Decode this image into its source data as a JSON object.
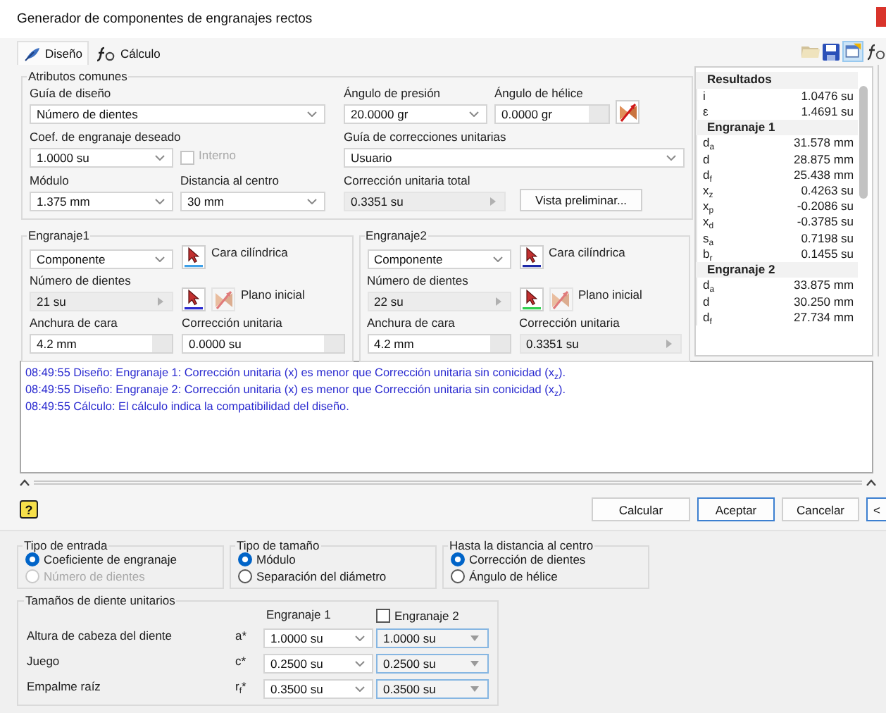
{
  "window": {
    "title": "Generador de componentes de engranajes rectos"
  },
  "tabs": [
    {
      "label": "Diseño",
      "selected": true
    },
    {
      "label": "Cálculo",
      "selected": false
    }
  ],
  "common": {
    "title": "Atributos comunes",
    "design_guide": {
      "label": "Guía de diseño",
      "value": "Número de dientes",
      "kind": "combo"
    },
    "pressure_angle": {
      "label": "Ángulo de presión",
      "value": "20.0000 gr",
      "kind": "combo"
    },
    "helix_angle": {
      "label": "Ángulo de hélice",
      "value": "0.0000 gr",
      "kind": "text"
    },
    "gear_ratio": {
      "label": "Coef. de engranaje deseado",
      "value": "1.0000 su",
      "kind": "combo"
    },
    "internal": {
      "label": "Interno",
      "checked": false,
      "disabled": true
    },
    "correction_guide": {
      "label": "Guía de correcciones unitarias",
      "value": "Usuario",
      "kind": "combo"
    },
    "module": {
      "label": "Módulo",
      "value": "1.375 mm",
      "kind": "combo"
    },
    "center_distance": {
      "label": "Distancia al centro",
      "value": "30 mm",
      "kind": "combo"
    },
    "total_correction": {
      "label": "Corrección unitaria total",
      "value": "0.3351 su",
      "kind": "spin"
    },
    "preview_button": "Vista preliminar..."
  },
  "gears": [
    {
      "title": "Engranaje1",
      "component": {
        "value": "Componente",
        "kind": "combo"
      },
      "cylinder_face": "Cara cilíndrica",
      "start_plane": "Plano inicial",
      "teeth": {
        "label": "Número de dientes",
        "value": "21 su",
        "kind": "spin"
      },
      "face_width": {
        "label": "Anchura de cara",
        "value": "4.2 mm",
        "kind": "text"
      },
      "correction": {
        "label": "Corrección unitaria",
        "value": "0.0000 su",
        "kind": "text"
      }
    },
    {
      "title": "Engranaje2",
      "component": {
        "value": "Componente",
        "kind": "combo"
      },
      "cylinder_face": "Cara cilíndrica",
      "start_plane": "Plano inicial",
      "teeth": {
        "label": "Número de dientes",
        "value": "22 su",
        "kind": "spin"
      },
      "face_width": {
        "label": "Anchura de cara",
        "value": "4.2 mm",
        "kind": "text"
      },
      "correction": {
        "label": "Corrección unitaria",
        "value": "0.3351 su",
        "kind": "spin"
      }
    }
  ],
  "results": {
    "title": "Resultados",
    "rows": [
      {
        "kind": "row",
        "symbol": "i",
        "value": "1.0476 su"
      },
      {
        "kind": "row",
        "symbol": "ε",
        "value": "1.4691 su"
      },
      {
        "kind": "header",
        "symbol": "Engranaje 1"
      },
      {
        "kind": "row",
        "symbol": "d$_{a}$",
        "value": "31.578 mm"
      },
      {
        "kind": "row",
        "symbol": "d",
        "value": "28.875 mm"
      },
      {
        "kind": "row",
        "symbol": "d$_{f}$",
        "value": "25.438 mm"
      },
      {
        "kind": "row",
        "symbol": "x$_{z}$",
        "value": "0.4263 su"
      },
      {
        "kind": "row",
        "symbol": "x$_{p}$",
        "value": "-0.2086 su"
      },
      {
        "kind": "row",
        "symbol": "x$_{d}$",
        "value": "-0.3785 su"
      },
      {
        "kind": "row",
        "symbol": "s$_{a}$",
        "value": "0.7198 su"
      },
      {
        "kind": "row",
        "symbol": "b$_{r}$",
        "value": "0.1455 su"
      },
      {
        "kind": "header",
        "symbol": "Engranaje 2"
      },
      {
        "kind": "row",
        "symbol": "d$_{a}$",
        "value": "33.875 mm"
      },
      {
        "kind": "row",
        "symbol": "d",
        "value": "30.250 mm"
      },
      {
        "kind": "row",
        "symbol": "d$_{f}$",
        "value": "27.734 mm"
      }
    ]
  },
  "log": [
    "08:49:55 Diseño: Engranaje 1: Corrección unitaria (x) es menor que Corrección unitaria sin conicidad (x$_{z}$).",
    "08:49:55 Diseño: Engranaje 2: Corrección unitaria (x) es menor que Corrección unitaria sin conicidad (x$_{z}$).",
    "08:49:55 Cálculo: El cálculo indica la compatibilidad del diseño."
  ],
  "help": "?",
  "buttons": [
    {
      "label": "Calcular",
      "default": false
    },
    {
      "label": "Aceptar",
      "default": true
    },
    {
      "label": "Cancelar",
      "default": false
    },
    {
      "label": "<",
      "default": true
    }
  ],
  "option_groups": [
    {
      "title": "Tipo de entrada",
      "options": [
        {
          "label": "Coeficiente de engranaje",
          "selected": true,
          "disabled": false
        },
        {
          "label": "Número de dientes",
          "selected": false,
          "disabled": true
        }
      ]
    },
    {
      "title": "Tipo de tamaño",
      "options": [
        {
          "label": "Módulo",
          "selected": true,
          "disabled": false
        },
        {
          "label": "Separación del diámetro",
          "selected": false,
          "disabled": false
        }
      ]
    },
    {
      "title": "Hasta la distancia al centro",
      "options": [
        {
          "label": "Corrección de dientes",
          "selected": true,
          "disabled": false
        },
        {
          "label": "Ángulo de hélice",
          "selected": false,
          "disabled": false
        }
      ]
    }
  ],
  "tooth_sizes": {
    "title": "Tamaños de diente unitarios",
    "column_1": "Engranaje 1",
    "column_2": {
      "label": "Engranaje 2",
      "checked": false
    },
    "rows": [
      {
        "label": "Altura de cabeza del diente",
        "symbol": "a*",
        "gear_1": {
          "value": "1.0000 su",
          "kind": "combo"
        },
        "gear_2": {
          "value": "1.0000 su",
          "kind": "locked"
        }
      },
      {
        "label": "Juego",
        "symbol": "c*",
        "gear_1": {
          "value": "0.2500 su",
          "kind": "combo"
        },
        "gear_2": {
          "value": "0.2500 su",
          "kind": "locked"
        }
      },
      {
        "label": "Empalme raíz",
        "symbol": "r$_{f}$*",
        "gear_1": {
          "value": "0.3500 su",
          "kind": "combo"
        },
        "gear_2": {
          "value": "0.3500 su",
          "kind": "locked"
        }
      }
    ]
  }
}
